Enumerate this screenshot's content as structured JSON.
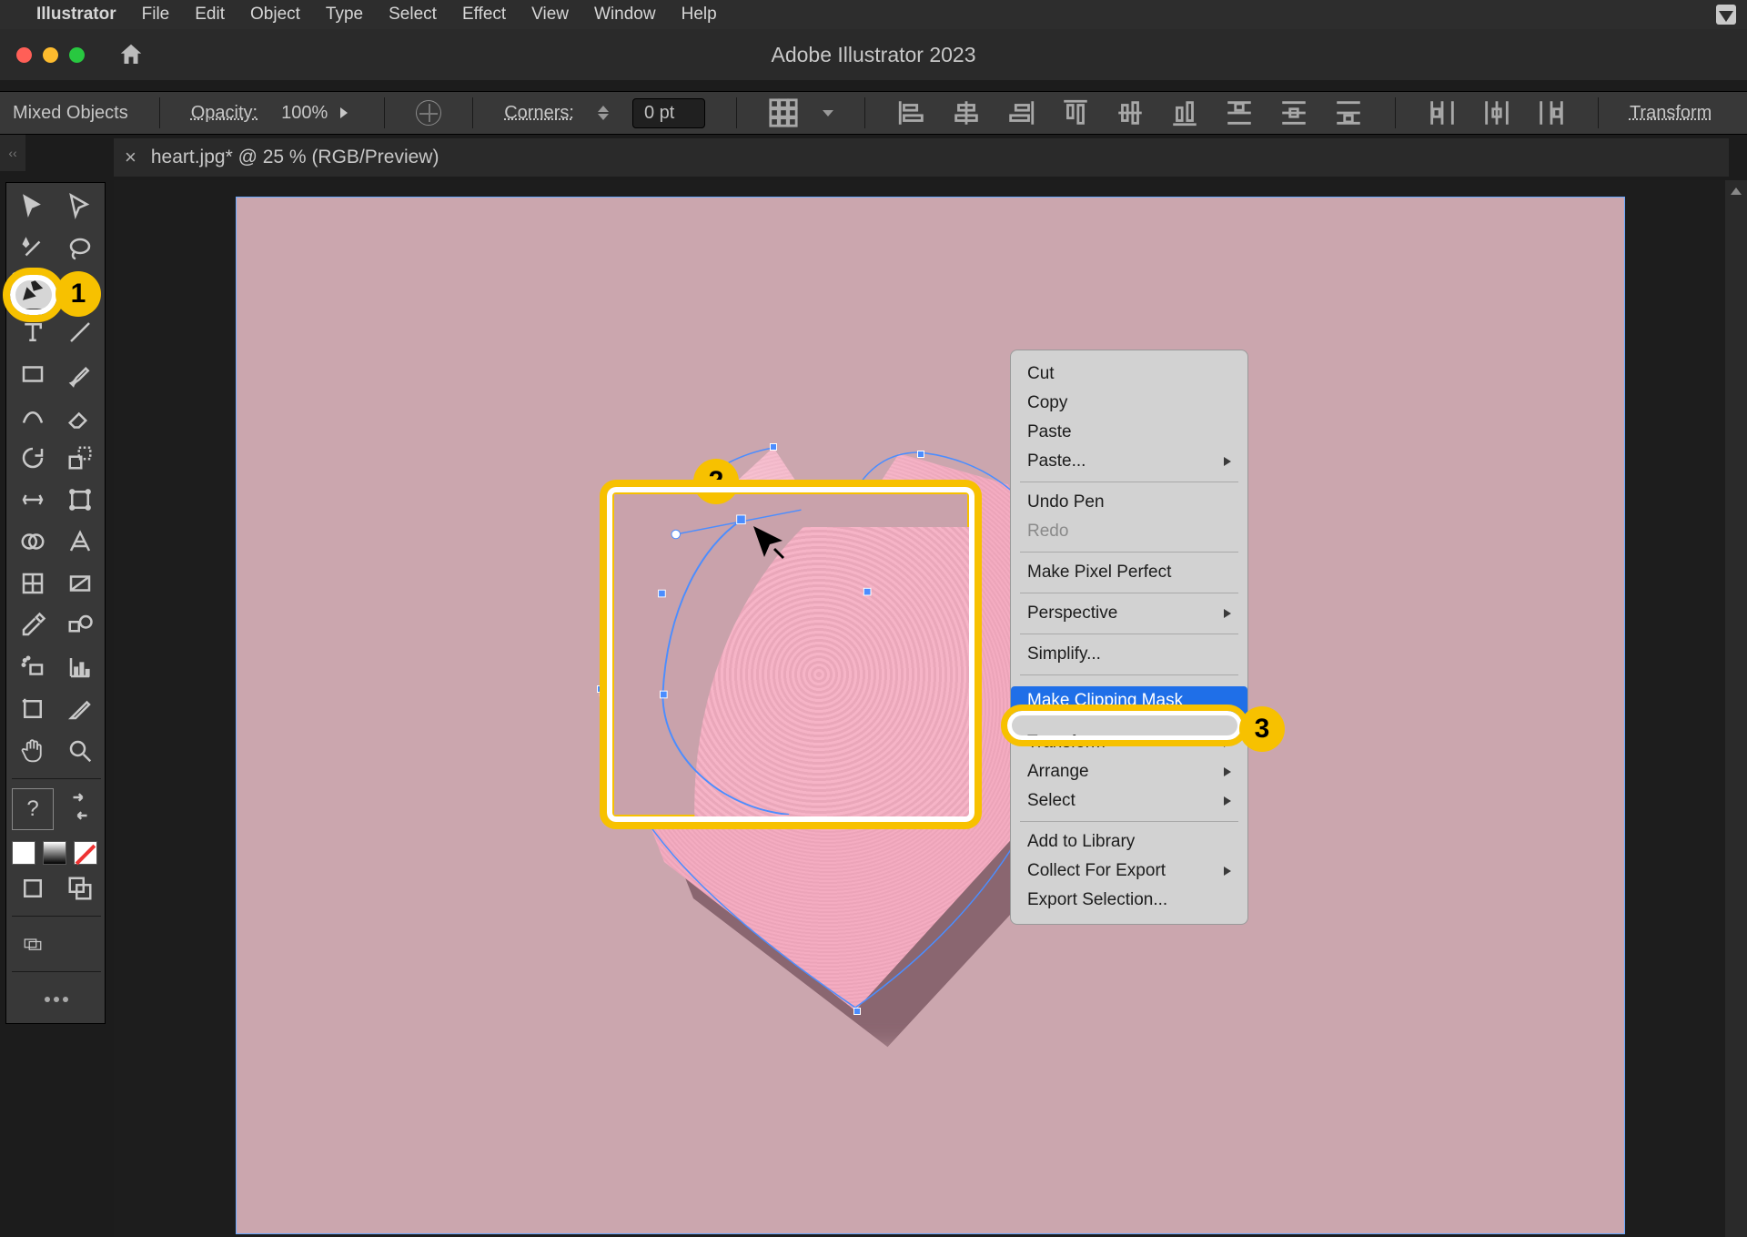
{
  "menubar": {
    "app": "Illustrator",
    "items": [
      "File",
      "Edit",
      "Object",
      "Type",
      "Select",
      "Effect",
      "View",
      "Window",
      "Help"
    ]
  },
  "window": {
    "title": "Adobe Illustrator 2023"
  },
  "options": {
    "selection": "Mixed Objects",
    "opacity_label": "Opacity:",
    "opacity_value": "100%",
    "corners_label": "Corners:",
    "corners_value": "0 pt",
    "transform": "Transform"
  },
  "tab": {
    "name": "heart.jpg* @ 25 % (RGB/Preview)"
  },
  "callouts": {
    "c1": "1",
    "c2": "2",
    "c3": "3"
  },
  "context_menu": {
    "cut": "Cut",
    "copy": "Copy",
    "paste": "Paste",
    "paste_sub": "Paste...",
    "undo": "Undo Pen",
    "redo": "Redo",
    "pixel": "Make Pixel Perfect",
    "perspective": "Perspective",
    "simplify": "Simplify...",
    "group_hidden": "",
    "make_mask": "Make Clipping Mask",
    "transform": "Transform",
    "arrange": "Arrange",
    "select": "Select",
    "add_lib": "Add to Library",
    "collect": "Collect For Export",
    "export": "Export Selection..."
  },
  "tools": [
    "selection-tool",
    "direct-selection-tool",
    "magic-wand-tool",
    "lasso-tool",
    "pen-tool",
    "curvature-tool",
    "type-tool",
    "line-tool",
    "rectangle-tool",
    "paintbrush-tool",
    "shaper-tool",
    "eraser-tool",
    "rotate-tool",
    "scale-tool",
    "width-tool",
    "free-transform-tool",
    "shape-builder-tool",
    "perspective-grid-tool",
    "mesh-tool",
    "gradient-tool",
    "eyedropper-tool",
    "blend-tool",
    "symbol-sprayer-tool",
    "graph-tool",
    "artboard-tool",
    "slice-tool",
    "hand-tool",
    "zoom-tool"
  ]
}
